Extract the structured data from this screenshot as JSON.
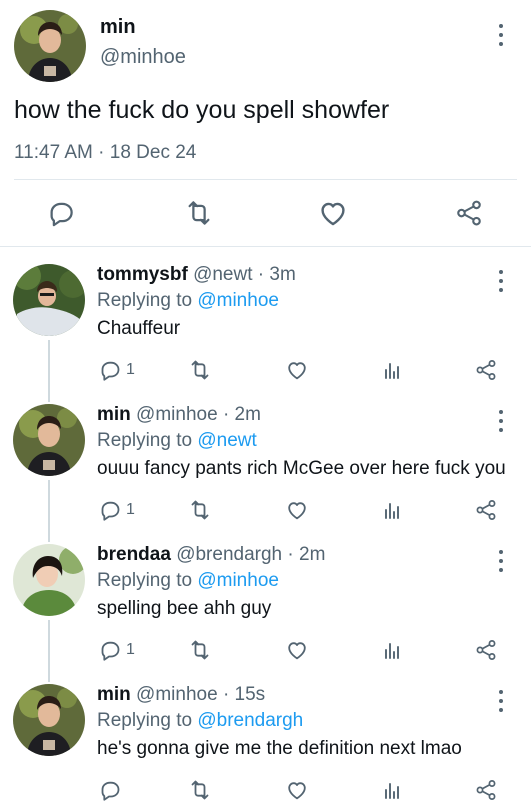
{
  "main": {
    "name": "min",
    "handle": "@minhoe",
    "text": "how the fuck do you spell showfer",
    "timestamp": "11:47 AM · 18 Dec 24"
  },
  "icons": {
    "reply": "reply-icon",
    "retweet": "retweet-icon",
    "like": "heart-icon",
    "views": "analytics-icon",
    "share": "share-icon",
    "more": "more-vertical-icon"
  },
  "colors": {
    "text": "#0f1419",
    "secondary": "#536471",
    "link": "#1d9bf0",
    "divider": "#e1e8ed"
  },
  "replies": [
    {
      "name": "tommysbf",
      "meta": " @newt · 3m",
      "replying_prefix": "Replying to ",
      "replying_to": "@minhoe",
      "text": "Chauffeur",
      "reply_count": "1"
    },
    {
      "name": "min",
      "meta": " @minhoe · 2m",
      "replying_prefix": "Replying to ",
      "replying_to": "@newt",
      "text": "ouuu fancy pants rich McGee over here fuck you",
      "reply_count": "1"
    },
    {
      "name": "brendaa",
      "meta": " @brendargh · 2m",
      "replying_prefix": "Replying to ",
      "replying_to": "@minhoe",
      "text": "spelling bee ahh guy",
      "reply_count": "1"
    },
    {
      "name": "min",
      "meta": " @minhoe · 15s",
      "replying_prefix": "Replying to ",
      "replying_to": "@brendargh",
      "text": "he's gonna give me the definition next lmao",
      "reply_count": ""
    }
  ]
}
